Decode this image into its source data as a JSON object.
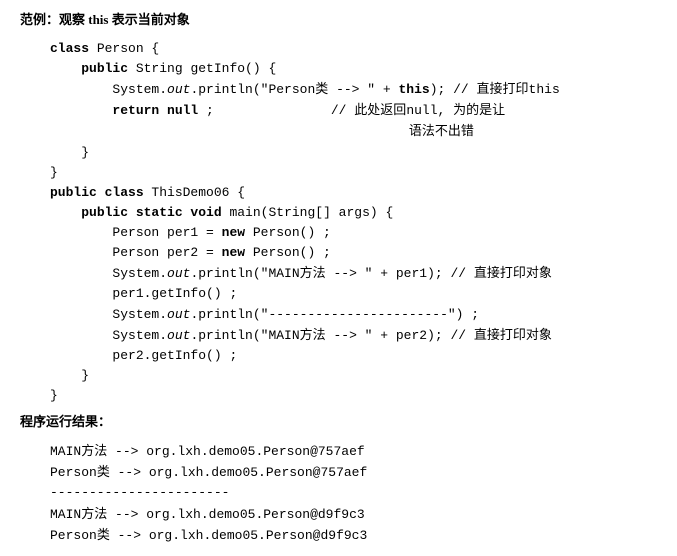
{
  "example_title": "范例：观察 this 表示当前对象",
  "code": {
    "c1": "class",
    "c2": " Person {",
    "c3": "public",
    "c4": " String getInfo() {",
    "c5": "System.",
    "c6": "out",
    "c7": ".println(\"Person",
    "c7cn": "类",
    "c7b": " --> \" + ",
    "c8": "this",
    "c9": "); // ",
    "c9cn": "直接打印",
    "c9b": "this",
    "c10": "return null",
    "c11": " ;",
    "c12": "               // ",
    "c12cn": "此处返回",
    "c12b": "null, ",
    "c12cn2": "为的是让",
    "c13cn": "语法不出错",
    "c14": "}",
    "c15": "}",
    "c16": "public class",
    "c17": " ThisDemo06 {",
    "c18": "public static void",
    "c19": " main(String[] args) {",
    "c20": "Person per1 = ",
    "c21": "new",
    "c22": " Person() ;",
    "c23": "Person per2 = ",
    "c24": "new",
    "c25": " Person() ;",
    "c26": "System.",
    "c27": "out",
    "c28": ".println(\"MAIN",
    "c28cn": "方法",
    "c28b": " --> \" + per1); // ",
    "c28cn2": "直接打印对象",
    "c29": "per1.getInfo() ;",
    "c30": "System.",
    "c31": "out",
    "c32": ".println(\"-----------------------\") ;",
    "c33": "System.",
    "c34": "out",
    "c35": ".println(\"MAIN",
    "c35cn": "方法",
    "c35b": " --> \" + per2); // ",
    "c35cn2": "直接打印对象",
    "c36": "per2.getInfo() ;",
    "c37": "}",
    "c38": "}"
  },
  "output_title": "程序运行结果：",
  "output": {
    "l1a": "MAIN",
    "l1cn": "方法",
    "l1b": " --> org.lxh.demo05.Person@757aef",
    "l2a": "Person",
    "l2cn": "类",
    "l2b": " --> org.lxh.demo05.Person@757aef",
    "l3": "-----------------------",
    "l4a": "MAIN",
    "l4cn": "方法",
    "l4b": " --> org.lxh.demo05.Person@d9f9c3",
    "l5a": "Person",
    "l5cn": "类",
    "l5b": " --> org.lxh.demo05.Person@d9f9c3"
  }
}
